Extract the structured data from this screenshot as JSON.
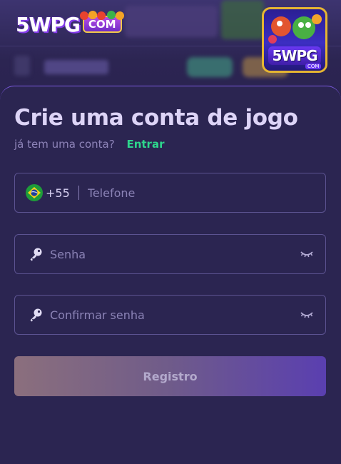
{
  "header": {
    "logo_text": "5WPG",
    "logo_suffix": "COM",
    "app_icon_text": "5WPG",
    "app_icon_suffix": "COM"
  },
  "form": {
    "title": "Crie uma conta de jogo",
    "login_prompt": "já tem uma conta?",
    "login_link": "Entrar",
    "phone": {
      "country_code": "+55",
      "placeholder": "Telefone",
      "flag": "brazil-flag-icon"
    },
    "password": {
      "placeholder": "Senha",
      "icon": "key-icon",
      "toggle_icon": "eye-closed-icon"
    },
    "confirm_password": {
      "placeholder": "Confirmar senha",
      "icon": "key-icon",
      "toggle_icon": "eye-closed-icon"
    },
    "submit_label": "Registro"
  },
  "colors": {
    "background": "#241d40",
    "card": "#2b2551",
    "accent_link": "#2ed58c",
    "field_border": "#5c5391",
    "title": "#ddd4f7"
  }
}
